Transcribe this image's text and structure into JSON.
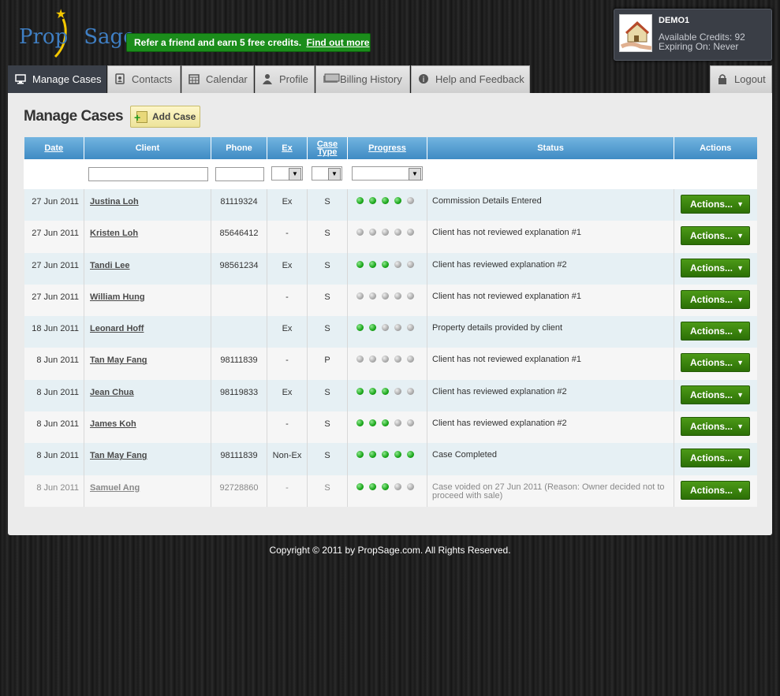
{
  "brand": {
    "logo_text": "PropSage"
  },
  "promo": {
    "text": "Refer a friend and earn 5 free credits.",
    "link": "Find out more"
  },
  "account": {
    "username": "DEMO1",
    "credits": "Available Credits: 92",
    "expiry": "Expiring On: Never"
  },
  "nav": {
    "tabs": [
      {
        "label": "Manage Cases",
        "icon": "monitor-icon",
        "active": true
      },
      {
        "label": "Contacts",
        "icon": "contacts-icon"
      },
      {
        "label": "Calendar",
        "icon": "calendar-icon"
      },
      {
        "label": "Profile",
        "icon": "user-icon"
      },
      {
        "label": "Billing History",
        "icon": "money-icon"
      },
      {
        "label": "Help and Feedback",
        "icon": "help-icon"
      }
    ],
    "logout": "Logout"
  },
  "page": {
    "title": "Manage Cases",
    "add_button": "Add Case"
  },
  "table": {
    "headers": {
      "date": "Date",
      "client": "Client",
      "phone": "Phone",
      "ex": "Ex",
      "case_type_1": "Case",
      "case_type_2": "Type",
      "progress": "Progress",
      "status": "Status",
      "actions": "Actions"
    },
    "rows": [
      {
        "date": "27 Jun 2011",
        "client": "Justina Loh",
        "phone": "81119324",
        "ex": "Ex",
        "type": "S",
        "progress": 4,
        "status": "Commission Details Entered",
        "action": "Actions..."
      },
      {
        "date": "27 Jun 2011",
        "client": "Kristen Loh",
        "phone": "85646412",
        "ex": "-",
        "type": "S",
        "progress": 0,
        "status": "Client has not reviewed explanation #1",
        "action": "Actions..."
      },
      {
        "date": "27 Jun 2011",
        "client": "Tandi Lee",
        "phone": "98561234",
        "ex": "Ex",
        "type": "S",
        "progress": 3,
        "status": "Client has reviewed explanation #2",
        "action": "Actions..."
      },
      {
        "date": "27 Jun 2011",
        "client": "William Hung",
        "phone": "",
        "ex": "-",
        "type": "S",
        "progress": 0,
        "status": "Client has not reviewed explanation #1",
        "action": "Actions..."
      },
      {
        "date": "18 Jun 2011",
        "client": "Leonard Hoff",
        "phone": "",
        "ex": "Ex",
        "type": "S",
        "progress": 2,
        "status": "Property details provided by client",
        "action": "Actions..."
      },
      {
        "date": "8 Jun 2011",
        "client": "Tan May Fang",
        "phone": "98111839",
        "ex": "-",
        "type": "P",
        "progress": 0,
        "status": "Client has not reviewed explanation #1",
        "action": "Actions..."
      },
      {
        "date": "8 Jun 2011",
        "client": "Jean Chua",
        "phone": "98119833",
        "ex": "Ex",
        "type": "S",
        "progress": 3,
        "status": "Client has reviewed explanation #2",
        "action": "Actions..."
      },
      {
        "date": "8 Jun 2011",
        "client": "James Koh",
        "phone": "",
        "ex": "-",
        "type": "S",
        "progress": 3,
        "status": "Client has reviewed explanation #2",
        "action": "Actions..."
      },
      {
        "date": "8 Jun 2011",
        "client": "Tan May Fang",
        "phone": "98111839",
        "ex": "Non-Ex",
        "type": "S",
        "progress": 5,
        "status": "Case Completed",
        "action": "Actions..."
      },
      {
        "date": "8 Jun 2011",
        "client": "Samuel Ang",
        "phone": "92728860",
        "ex": "-",
        "type": "S",
        "progress": 3,
        "status": "Case voided on 27 Jun 2011 (Reason: Owner decided not to proceed with sale)",
        "action": "Actions...",
        "voided": true
      }
    ]
  },
  "footer": {
    "text": "Copyright © 2011 by PropSage.com. All Rights Reserved."
  },
  "colors": {
    "header_blue": "#4a95cc",
    "action_green": "#3d8a10",
    "promo_green": "#1b8d1b",
    "progress_on": "#1aa61a",
    "progress_off": "#aaaaaa"
  }
}
